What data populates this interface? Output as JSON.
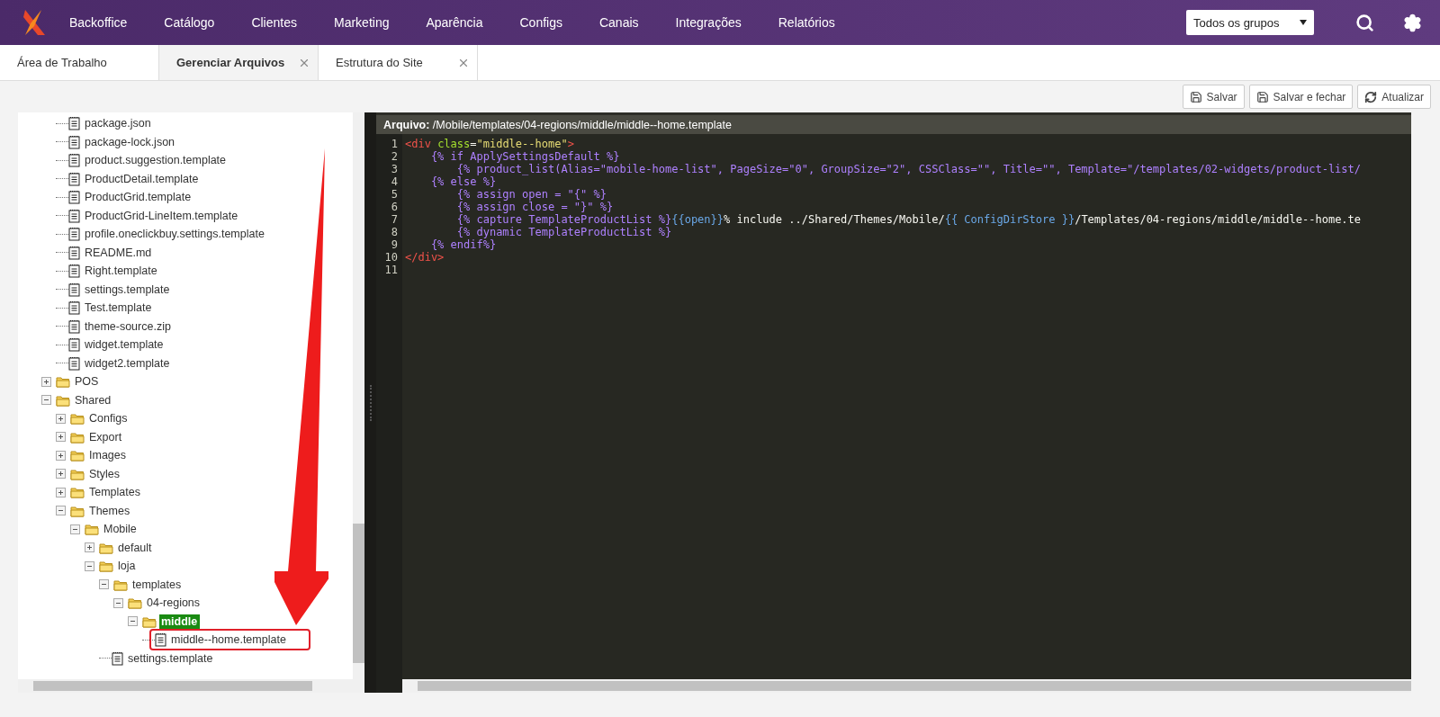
{
  "header": {
    "nav": [
      "Backoffice",
      "Catálogo",
      "Clientes",
      "Marketing",
      "Aparência",
      "Configs",
      "Canais",
      "Integrações",
      "Relatórios"
    ],
    "group_select": {
      "value": "Todos os grupos"
    }
  },
  "tabs": [
    {
      "label": "Área de Trabalho",
      "selected": false,
      "closable": false
    },
    {
      "label": "Gerenciar Arquivos",
      "selected": true,
      "closable": true
    },
    {
      "label": "Estrutura do Site",
      "selected": false,
      "closable": true
    }
  ],
  "toolbar": [
    {
      "label": "Salvar",
      "kind": "save"
    },
    {
      "label": "Salvar e fechar",
      "kind": "save"
    },
    {
      "label": "Atualizar",
      "kind": "refresh"
    }
  ],
  "tree": [
    {
      "children": [
        {
          "label": "package.json",
          "kind": "file",
          "selected": false,
          "outlined": false
        },
        {
          "label": "package-lock.json",
          "kind": "file",
          "selected": false,
          "outlined": false
        },
        {
          "label": "product.suggestion.template",
          "kind": "file",
          "selected": false,
          "outlined": false
        },
        {
          "label": "ProductDetail.template",
          "kind": "file",
          "selected": false,
          "outlined": false
        },
        {
          "label": "ProductGrid.template",
          "kind": "file",
          "selected": false,
          "outlined": false
        },
        {
          "label": "ProductGrid-LineItem.template",
          "kind": "file",
          "selected": false,
          "outlined": false
        },
        {
          "label": "profile.oneclickbuy.settings.template",
          "kind": "file",
          "selected": false,
          "outlined": false
        },
        {
          "label": "README.md",
          "kind": "file",
          "selected": false,
          "outlined": false
        },
        {
          "label": "Right.template",
          "kind": "file",
          "selected": false,
          "outlined": false
        },
        {
          "label": "settings.template",
          "kind": "file",
          "selected": false,
          "outlined": false
        },
        {
          "label": "Test.template",
          "kind": "file",
          "selected": false,
          "outlined": false
        },
        {
          "label": "theme-source.zip",
          "kind": "file",
          "selected": false,
          "outlined": false
        },
        {
          "label": "widget.template",
          "kind": "file",
          "selected": false,
          "outlined": false
        },
        {
          "label": "widget2.template",
          "kind": "file",
          "selected": false,
          "outlined": false
        }
      ]
    },
    {
      "label": "POS",
      "kind": "folder",
      "expanded": false,
      "selected": false
    },
    {
      "label": "Shared",
      "kind": "folder",
      "expanded": true,
      "selected": false,
      "children": [
        {
          "label": "Configs",
          "kind": "folder",
          "expanded": false,
          "selected": false
        },
        {
          "label": "Export",
          "kind": "folder",
          "expanded": false,
          "selected": false
        },
        {
          "label": "Images",
          "kind": "folder",
          "expanded": false,
          "selected": false
        },
        {
          "label": "Styles",
          "kind": "folder",
          "expanded": false,
          "selected": false
        },
        {
          "label": "Templates",
          "kind": "folder",
          "expanded": false,
          "selected": false
        },
        {
          "label": "Themes",
          "kind": "folder",
          "expanded": true,
          "selected": false,
          "children": [
            {
              "label": "Mobile",
              "kind": "folder",
              "expanded": true,
              "selected": false,
              "children": [
                {
                  "label": "default",
                  "kind": "folder",
                  "expanded": false,
                  "selected": false
                },
                {
                  "label": "loja",
                  "kind": "folder",
                  "expanded": true,
                  "selected": false,
                  "children": [
                    {
                      "label": "templates",
                      "kind": "folder",
                      "expanded": true,
                      "selected": false,
                      "children": [
                        {
                          "label": "04-regions",
                          "kind": "folder",
                          "expanded": true,
                          "selected": false,
                          "children": [
                            {
                              "label": "middle",
                              "kind": "folder",
                              "expanded": true,
                              "selected": true,
                              "children": [
                                {
                                  "label": "middle--home.template",
                                  "kind": "file",
                                  "selected": false,
                                  "outlined": true
                                }
                              ]
                            }
                          ]
                        }
                      ]
                    },
                    {
                      "label": "settings.template",
                      "kind": "file",
                      "selected": false,
                      "outlined": false
                    }
                  ]
                }
              ]
            }
          ]
        }
      ]
    }
  ],
  "editor": {
    "path": "**Arquivo:** /Mobile/templates/04-regions/middle/middle--home.template",
    "lines": [
      {
        "number": "1",
        "segments": [
          {
            "kind": "tag",
            "text": "<div "
          },
          {
            "kind": "attr",
            "text": "class"
          },
          {
            "kind": "text",
            "text": "="
          },
          {
            "kind": "string",
            "text": "\"middle--home\""
          },
          {
            "kind": "tag",
            "text": ">"
          }
        ]
      },
      {
        "number": "2",
        "segments": [
          {
            "kind": "liquid",
            "text": "    {% if ApplySettingsDefault %}"
          }
        ]
      },
      {
        "number": "3",
        "segments": [
          {
            "kind": "liquid",
            "text": "        {% product_list(Alias=\"mobile-home-list\", PageSize=\"0\", GroupSize=\"2\", CSSClass=\"\", Title=\"\", Template=\"/templates/02-widgets/product-list/"
          }
        ]
      },
      {
        "number": "4",
        "segments": [
          {
            "kind": "liquid",
            "text": "    {% else %}"
          }
        ]
      },
      {
        "number": "5",
        "segments": [
          {
            "kind": "liquid",
            "text": "        {% assign open = \"{\" %}"
          }
        ]
      },
      {
        "number": "6",
        "segments": [
          {
            "kind": "liquid",
            "text": "        {% assign close = \"}\" %}"
          }
        ]
      },
      {
        "number": "7",
        "segments": [
          {
            "kind": "liquid",
            "text": "        {% capture TemplateProductList %}"
          },
          {
            "kind": "var",
            "text": "{{open}}"
          },
          {
            "kind": "text",
            "text": "% include ../Shared/Themes/Mobile/"
          },
          {
            "kind": "var",
            "text": "{{ ConfigDirStore }}"
          },
          {
            "kind": "text",
            "text": "/Templates/04-regions/middle/middle--home.te"
          }
        ]
      },
      {
        "number": "8",
        "segments": [
          {
            "kind": "liquid",
            "text": "        {% dynamic TemplateProductList %}"
          }
        ]
      },
      {
        "number": "9",
        "segments": [
          {
            "kind": "liquid",
            "text": "    {% endif%}"
          }
        ]
      },
      {
        "number": "10",
        "segments": [
          {
            "kind": "tag",
            "text": "</div>"
          }
        ]
      },
      {
        "number": "11"
      }
    ]
  }
}
